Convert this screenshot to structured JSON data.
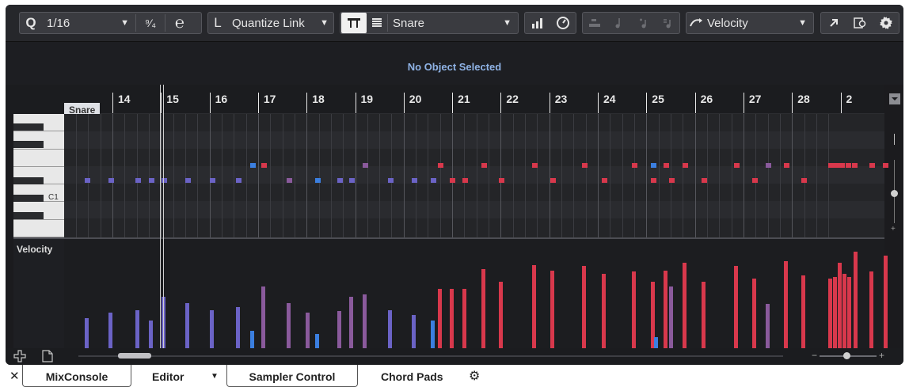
{
  "toolbar": {
    "quantize_icon": "Q",
    "quantize_value": "1/16",
    "quantize_dropdown": "▼",
    "iterative_quantize_icon": "⁹⁄₄",
    "quantize_preset_icon": "℮",
    "length_quantize_icon": "L",
    "length_quantize_value": "Quantize Link",
    "length_dropdown": "▼",
    "lane_selector_value": "Snare",
    "lane_dropdown": "▼",
    "controller_value": "Velocity",
    "controller_dropdown": "▼",
    "icons": [
      "quantize-icon",
      "iterative-quantize-icon",
      "quantize-preset-icon",
      "length-quantize-icon",
      "show-lane-icon",
      "lane-list-icon",
      "insert-velocity-icon",
      "tempo-icon",
      "step-input-icon",
      "move-insert-icon",
      "pitch-input-icon",
      "chord-input-icon",
      "controller-shape-icon",
      "open-in-window-icon",
      "export-icon",
      "settings-icon"
    ]
  },
  "info_line": "No Object Selected",
  "lane_tag": "Snare",
  "ruler": {
    "bars": [
      "14",
      "15",
      "16",
      "17",
      "18",
      "19",
      "20",
      "21",
      "22",
      "23",
      "24",
      "25",
      "26",
      "27",
      "28",
      "2"
    ]
  },
  "keyboard": {
    "c1_label": "C1"
  },
  "velocity_lane": {
    "label": "Velocity"
  },
  "tabs": {
    "close": "✕",
    "mixconsole": "MixConsole",
    "editor": "Editor",
    "editor_drop": "▼",
    "sampler": "Sampler Control",
    "chordpads": "Chord Pads",
    "settings": "⚙"
  },
  "colors": {
    "note_blue": "#6b63c6",
    "note_selected": "#3b7fe0",
    "note_red": "#d8384c",
    "note_purple": "#8a5a9c",
    "info_text": "#8fb3e6"
  }
}
